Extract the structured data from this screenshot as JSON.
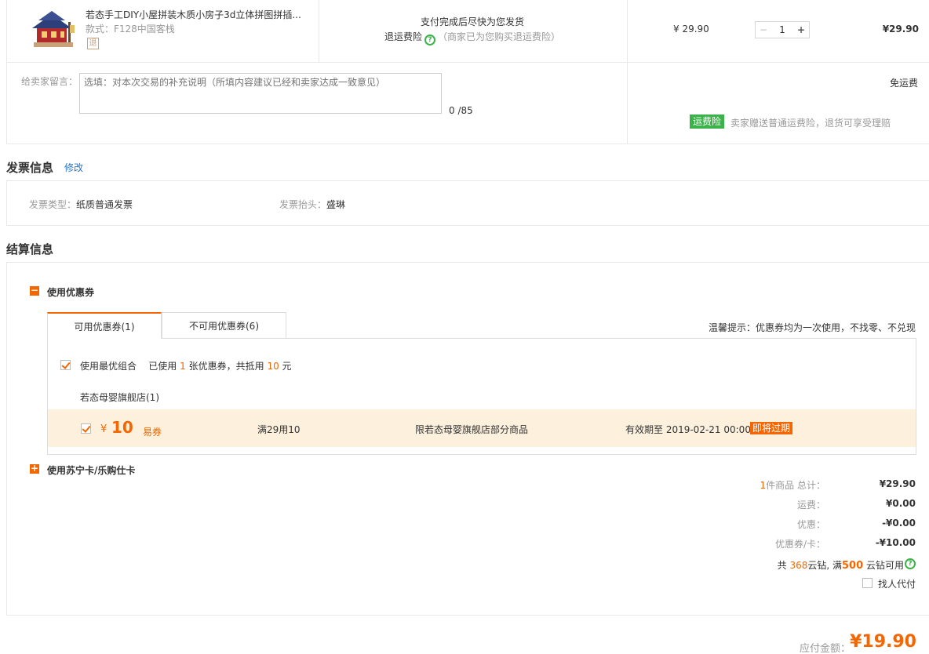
{
  "product": {
    "title": "若态手工DIY小屋拼装木质小房子3d立体拼图拼插...",
    "spec": "款式：F128中国客栈",
    "return_badge": "退",
    "ship_note": "支付完成后尽快为您发货",
    "return_insurance_label": "退运费险",
    "return_insurance_note": "（商家已为您购买退运费险）",
    "unit_price": "¥ 29.90",
    "quantity": "1",
    "line_total": "¥29.90"
  },
  "message": {
    "label": "给卖家留言：",
    "placeholder": "选填：对本次交易的补充说明（所填内容建议已经和卖家达成一致意见）",
    "count": "0 /85"
  },
  "shipping": {
    "fee": "免运费",
    "insurance_badge": "运费险",
    "insurance_text": "卖家赠送普通运费险，退货可享受理赔"
  },
  "invoice": {
    "title": "发票信息",
    "edit": "修改",
    "type_label": "发票类型：",
    "type_value": "纸质普通发票",
    "header_label": "发票抬头：",
    "header_value": "盛琳"
  },
  "settlement": {
    "title": "结算信息",
    "coupon_toggle": "使用优惠券",
    "tab_available": "可用优惠券(1)",
    "tab_unavailable": "不可用优惠券(6)",
    "tip": "温馨提示：优惠券均为一次使用，不找零、不兑现",
    "best_combo": "使用最优组合",
    "used_prefix": "已使用",
    "used_count": "1",
    "used_mid": "张优惠券，共抵用",
    "used_amount": "10",
    "used_suffix": "元",
    "store": "若态母婴旗舰店(1)",
    "coupon": {
      "yen": "¥",
      "amount": "10",
      "type": "易券",
      "condition": "满29用10",
      "scope": "限若态母婴旗舰店部分商品",
      "expiry": "有效期至 2019-02-21 00:00",
      "badge": "即将过期"
    },
    "card_toggle": "使用苏宁卡/乐购仕卡"
  },
  "summary": {
    "count": "1",
    "count_label": "件商品 总计：",
    "total": "¥29.90",
    "freight_label": "运费：",
    "freight": "¥0.00",
    "discount_label": "优惠：",
    "discount": "-¥0.00",
    "coupon_label": "优惠券/卡：",
    "coupon": "-¥10.00",
    "diamond_prefix": "共",
    "diamond_count": "368",
    "diamond_mid": "云钻, 满",
    "diamond_threshold": "500",
    "diamond_suffix": "云钻可用",
    "proxy_pay": "找人代付",
    "pay_label": "应付金额：",
    "pay_amount": "¥19.90"
  },
  "colors": {
    "accent": "#f56600",
    "green": "#3cb34a",
    "link": "#2a74c9",
    "coupon_bg": "#fdf1de"
  }
}
